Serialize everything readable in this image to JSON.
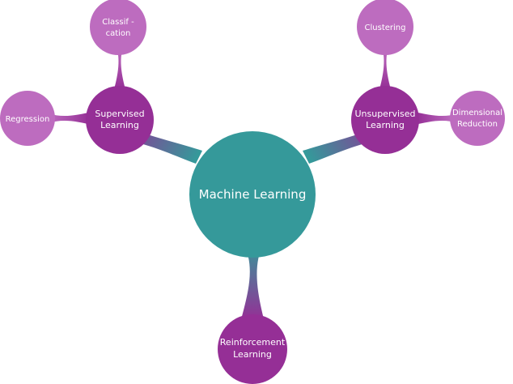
{
  "colors": {
    "center": "#35999a",
    "main": "#952f96",
    "leaf": "#bd6cbf",
    "text": "#ffffff",
    "background": "#ffffff"
  },
  "center": {
    "label": "Machine Learning"
  },
  "branches": {
    "supervised": {
      "label_lines": [
        "Supervised",
        "Learning"
      ],
      "children": {
        "classification": {
          "label_lines": [
            "Classif -",
            "cation"
          ]
        },
        "regression": {
          "label_lines": [
            "Regression"
          ]
        }
      }
    },
    "unsupervised": {
      "label_lines": [
        "Unsupervised",
        "Learning"
      ],
      "children": {
        "clustering": {
          "label_lines": [
            "Clustering"
          ]
        },
        "dimensional_reduction": {
          "label_lines": [
            "Dimensional",
            "Reduction"
          ]
        }
      }
    },
    "reinforcement": {
      "label_lines": [
        "Reinforcement",
        "Learning"
      ]
    }
  }
}
